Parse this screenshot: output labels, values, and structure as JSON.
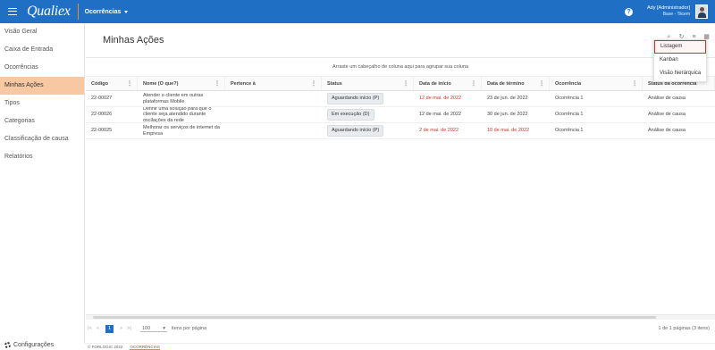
{
  "topbar": {
    "logo": "Qualiex",
    "module": "Ocorrências",
    "help": "?",
    "user_name": "Ady [Administrador]",
    "user_base": "Base - Tiicem"
  },
  "sidebar": {
    "items": [
      {
        "label": "Visão Geral"
      },
      {
        "label": "Caixa de Entrada"
      },
      {
        "label": "Ocorrências"
      },
      {
        "label": "Minhas Ações"
      },
      {
        "label": "Tipos"
      },
      {
        "label": "Categorias"
      },
      {
        "label": "Classificação de causa"
      },
      {
        "label": "Relatórios"
      }
    ],
    "active_index": 3,
    "config_label": "Configurações"
  },
  "main": {
    "title": "Minhas Ações",
    "group_hint": "Arraste um cabeçalho de coluna aqui para agrupar sua coluna",
    "columns": [
      "Código",
      "Nome (O que?)",
      "Pertence à",
      "Status",
      "Data de início",
      "Data de término",
      "Ocorrência",
      "Status da ocorrência"
    ],
    "rows": [
      {
        "code": "22-00027",
        "name": "Atender o cliente em outras plataformas Mobile",
        "pertence": "",
        "status": "Aguardando início (P)",
        "start": "12 de mai. de 2022",
        "start_late": true,
        "end": "23 de jun. de 2022",
        "end_late": false,
        "occurrence": "Ocorrência 1",
        "occ_status": "Análise de causa"
      },
      {
        "code": "22-00026",
        "name": "Definir uma solução para que o cliente seja atendido durante oscilações da rede",
        "pertence": "",
        "status": "Em execução (D)",
        "start": "12 de mai. de 2022",
        "start_late": false,
        "end": "30 de jun. de 2022",
        "end_late": false,
        "occurrence": "Ocorrência 1",
        "occ_status": "Análise de causa"
      },
      {
        "code": "22-00025",
        "name": "Melhorar os serviços de internet da Empresa",
        "pertence": "",
        "status": "Aguardando início (P)",
        "start": "2 de mai. de 2022",
        "start_late": true,
        "end": "10 de mai. de 2022",
        "end_late": true,
        "occurrence": "Ocorrência 1",
        "occ_status": "Análise de causa"
      }
    ]
  },
  "pager": {
    "first": "|<",
    "prev": "<",
    "current_page": "1",
    "next": ">",
    "last": ">|",
    "page_size": "100",
    "page_size_label": "itens por página",
    "info": "1 de 1 páginas (3 itens)"
  },
  "view_menu": {
    "items": [
      "Listagem",
      "Kanban",
      "Visão hierárquica"
    ],
    "selected": "Listagem"
  },
  "footer": {
    "copyright": "© FORLOGIC 2022",
    "section": "OCORRÊNCIAS"
  },
  "colors": {
    "topbar": "#1f6fc5",
    "accent": "#f08a2a",
    "active_sidebar": "#f7c8a1",
    "late_date": "#c0392b"
  }
}
